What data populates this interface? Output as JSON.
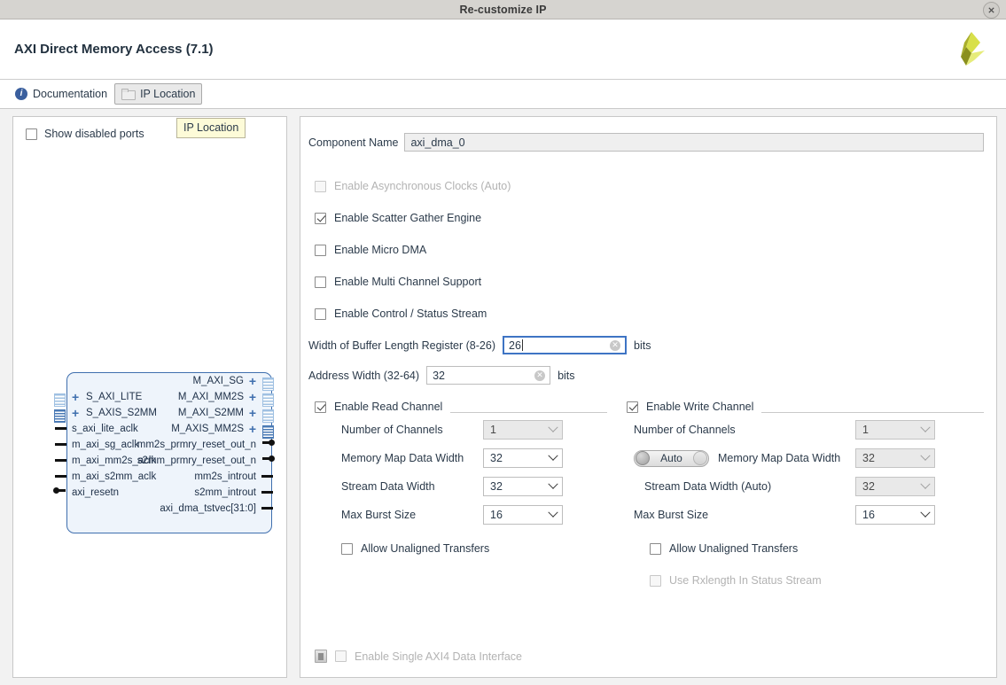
{
  "window": {
    "title": "Re-customize IP",
    "close_label": "✕"
  },
  "header": {
    "ip_title": "AXI Direct Memory Access (7.1)",
    "logo_name": "xilinx-logo"
  },
  "toolbar": {
    "documentation_label": "Documentation",
    "ip_location_label": "IP Location"
  },
  "tooltip": {
    "text": "IP Location"
  },
  "left_panel": {
    "show_disabled_ports_label": "Show disabled ports",
    "show_disabled_ports_checked": false
  },
  "diagram": {
    "left_ports": [
      {
        "label": "S_AXI_LITE",
        "kind": "bus"
      },
      {
        "label": "S_AXIS_S2MM",
        "kind": "bus"
      },
      {
        "label": "s_axi_lite_aclk",
        "kind": "pin"
      },
      {
        "label": "m_axi_sg_aclk",
        "kind": "pin"
      },
      {
        "label": "m_axi_mm2s_aclk",
        "kind": "pin"
      },
      {
        "label": "m_axi_s2mm_aclk",
        "kind": "pin"
      },
      {
        "label": "axi_resetn",
        "kind": "inv"
      }
    ],
    "right_ports": [
      {
        "label": "M_AXI_SG",
        "kind": "bus"
      },
      {
        "label": "M_AXI_MM2S",
        "kind": "bus"
      },
      {
        "label": "M_AXI_S2MM",
        "kind": "bus"
      },
      {
        "label": "M_AXIS_MM2S",
        "kind": "bus"
      },
      {
        "label": "mm2s_prmry_reset_out_n",
        "kind": "inv"
      },
      {
        "label": "s2mm_prmry_reset_out_n",
        "kind": "inv"
      },
      {
        "label": "mm2s_introut",
        "kind": "pin"
      },
      {
        "label": "s2mm_introut",
        "kind": "pin"
      },
      {
        "label": "axi_dma_tstvec[31:0]",
        "kind": "pin"
      }
    ]
  },
  "form": {
    "component_name_label": "Component Name",
    "component_name_value": "axi_dma_0",
    "options": [
      {
        "label": "Enable Asynchronous Clocks (Auto)",
        "checked": false,
        "disabled": true
      },
      {
        "label": "Enable Scatter Gather Engine",
        "checked": true,
        "disabled": false
      },
      {
        "label": "Enable Micro DMA",
        "checked": false,
        "disabled": false
      },
      {
        "label": "Enable Multi Channel Support",
        "checked": false,
        "disabled": false
      },
      {
        "label": "Enable Control / Status Stream",
        "checked": false,
        "disabled": false
      }
    ],
    "buffer_length": {
      "label": "Width of Buffer Length Register (8-26)",
      "value": "26",
      "units": "bits",
      "focused": true
    },
    "address_width": {
      "label": "Address Width (32-64)",
      "value": "32",
      "units": "bits",
      "focused": false
    },
    "read_channel": {
      "title": "Enable Read Channel",
      "checked": true,
      "fields": [
        {
          "label": "Number of Channels",
          "value": "1",
          "disabled": true
        },
        {
          "label": "Memory Map Data Width",
          "value": "32",
          "disabled": false
        },
        {
          "label": "Stream Data Width",
          "value": "32",
          "disabled": false
        },
        {
          "label": "Max Burst Size",
          "value": "16",
          "disabled": false
        }
      ],
      "allow_unaligned_label": "Allow Unaligned Transfers",
      "allow_unaligned_checked": false
    },
    "write_channel": {
      "title": "Enable Write Channel",
      "checked": true,
      "num_channels_label": "Number of Channels",
      "num_channels_value": "1",
      "auto_toggle_label": "Auto",
      "mm_data_width_label": "Memory Map Data Width",
      "mm_data_width_value": "32",
      "stream_data_width_label": "Stream Data Width (Auto)",
      "stream_data_width_value": "32",
      "max_burst_label": "Max Burst Size",
      "max_burst_value": "16",
      "allow_unaligned_label": "Allow Unaligned Transfers",
      "allow_unaligned_checked": false,
      "use_rxlength_label": "Use Rxlength In Status Stream",
      "use_rxlength_checked": false
    },
    "single_axi4": {
      "label": "Enable Single AXI4 Data Interface",
      "checked": false,
      "disabled": true,
      "icon_name": "document-icon"
    }
  },
  "colors": {
    "accent_blue": "#3e74c4",
    "block_border": "#3f6fae",
    "block_fill": "#eef4fb",
    "tooltip_bg": "#fdfbd8",
    "logo_dark": "#8a8f1e",
    "logo_light": "#d8e04a"
  }
}
